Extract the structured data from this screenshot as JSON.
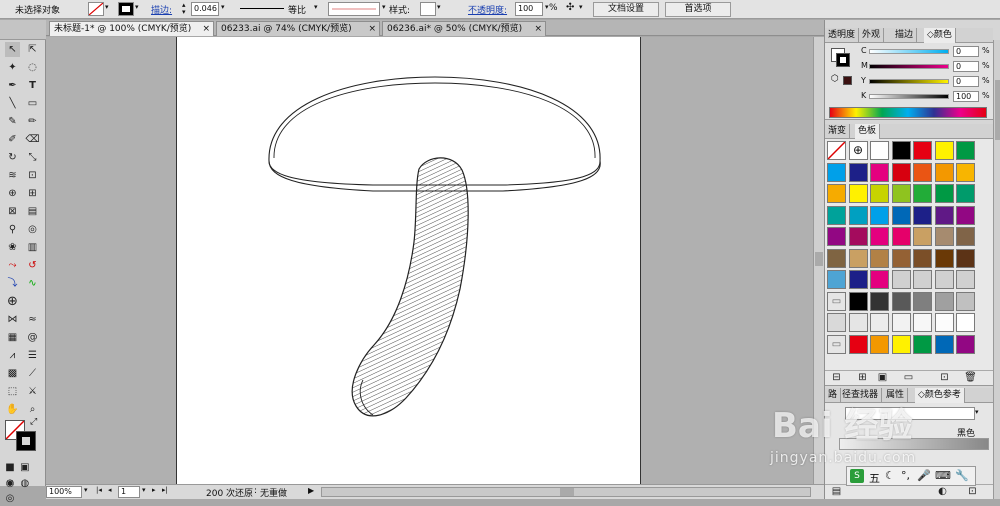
{
  "control_bar": {
    "selection_label": "未选择对象",
    "stroke_label": "描边:",
    "stroke_value": "0.046",
    "profile_label": "等比",
    "style_label": "样式:",
    "opacity_label": "不透明度:",
    "opacity_value": "100",
    "opacity_unit": "%",
    "doc_setup_label": "文档设置",
    "prefs_label": "首选项"
  },
  "tabs": [
    {
      "label": "未标题-1* @ 100% (CMYK/预览)",
      "close": "×"
    },
    {
      "label": "06233.ai @ 74% (CMYK/预览)",
      "close": "×"
    },
    {
      "label": "06236.ai* @ 50% (CMYK/预览)",
      "close": "×"
    }
  ],
  "color_panel": {
    "tabs": [
      "透明度",
      "外观",
      "描边",
      "颜色"
    ],
    "channels": [
      {
        "name": "C",
        "value": "0"
      },
      {
        "name": "M",
        "value": "0"
      },
      {
        "name": "Y",
        "value": "0"
      },
      {
        "name": "K",
        "value": "100"
      }
    ],
    "unit": "%"
  },
  "swatches_panel": {
    "tabs": [
      "渐变",
      "色板"
    ],
    "rows": [
      [
        "#ffffff",
        "#ffffff",
        "#ffffff",
        "#000000",
        "#e60012",
        "#fff100",
        "#009944"
      ],
      [
        "#00a0e9",
        "#1d2088",
        "#e4007f",
        "#d7000f",
        "#ea5514",
        "#f39800",
        "#f8b500"
      ],
      [
        "#f6ab00",
        "#fff100",
        "#c7d300",
        "#8fc31f",
        "#22ac38",
        "#009944",
        "#009b6b"
      ],
      [
        "#00a29a",
        "#00a0c1",
        "#00a0e9",
        "#0068b7",
        "#1d2088",
        "#601986",
        "#920783"
      ],
      [
        "#920783",
        "#a40b5d",
        "#e4007f",
        "#e5006a",
        "#c9a063",
        "#a68b6f",
        "#806448"
      ],
      [
        "#7f6442",
        "#c9a063",
        "#b28146",
        "#946134",
        "#7b4f28",
        "#6a3906",
        "#5c3316"
      ],
      [
        "#4ea4d4",
        "#1d2088",
        "#e4007f",
        "#d0d0d0",
        "#d0d0d0",
        "#d0d0d0",
        "#d0d0d0"
      ],
      [
        "#e5e5e5",
        "#000000",
        "#333333",
        "#595959",
        "#7f7f7f",
        "#a0a0a0",
        "#c0c0c0"
      ],
      [
        "#d9d9d9",
        "#e5e5e5",
        "#ececec",
        "#f2f2f2",
        "#f7f7f7",
        "#fcfcfc",
        "#ffffff"
      ],
      [
        "#e5e5e5",
        "#e60012",
        "#f39800",
        "#fff100",
        "#009944",
        "#0068b7",
        "#920783"
      ]
    ]
  },
  "bottom_panel": {
    "tabs": [
      "路",
      "径查找器",
      "属性",
      "颜色参考"
    ],
    "value": "黑色"
  },
  "status_bar": {
    "zoom": "100%",
    "page": "1",
    "undo_text": "200 次还原",
    "redo_text": "无重做",
    "tray_text": "五"
  },
  "watermark": {
    "text": "Bai 经验",
    "url": "jingyan.baidu.com"
  }
}
